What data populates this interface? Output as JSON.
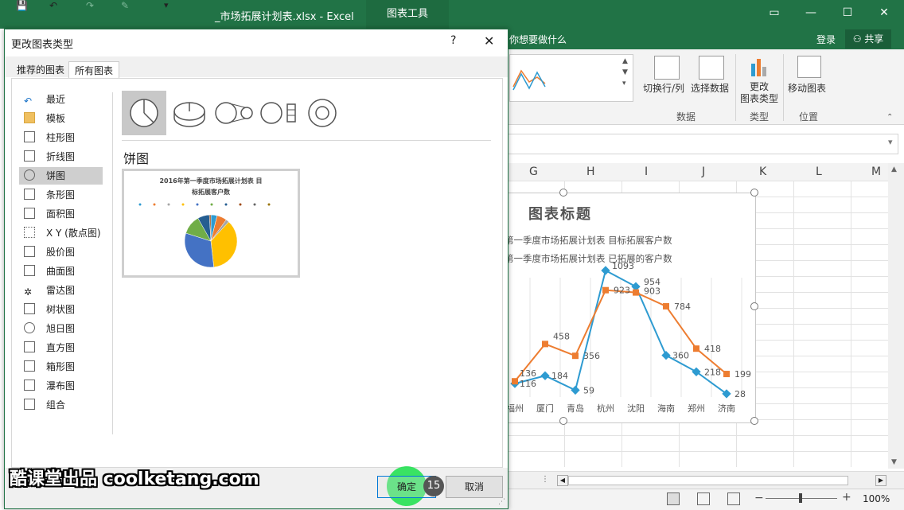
{
  "excel": {
    "filename": "_市场拓展计划表.xlsx - Excel",
    "context_tab": "图表工具",
    "tell_me": "你想要做什么",
    "sign_in": "登录",
    "share": "共享",
    "ribbon": {
      "switch_row_col": "切换行/列",
      "select_data": "选择数据",
      "change_type": "更改\n图表类型",
      "move_chart": "移动图表",
      "group_data": "数据",
      "group_type": "类型",
      "group_location": "位置"
    },
    "columns": [
      "G",
      "H",
      "I",
      "J",
      "K",
      "L",
      "M"
    ],
    "zoom": "100%"
  },
  "chart": {
    "title": "图表标题",
    "legend_1": "第一季度市场拓展计划表 目标拓展客户数",
    "legend_2": "第一季度市场拓展计划表 已拓展的客户数",
    "colors": {
      "series1": "#2e9bd1",
      "series2": "#ed7d31"
    },
    "categories": [
      "福州",
      "厦门",
      "青岛",
      "杭州",
      "沈阳",
      "海南",
      "郑州",
      "济南"
    ]
  },
  "chart_data": {
    "type": "line",
    "categories": [
      "福州",
      "厦门",
      "青岛",
      "杭州",
      "沈阳",
      "海南",
      "郑州",
      "济南"
    ],
    "series": [
      {
        "name": "第一季度市场拓展计划表 目标拓展客户数",
        "values": [
          116,
          184,
          59,
          1093,
          954,
          360,
          218,
          28
        ]
      },
      {
        "name": "第一季度市场拓展计划表 已拓展的客户数",
        "values": [
          136,
          458,
          356,
          923,
          903,
          784,
          418,
          199
        ]
      }
    ],
    "title": "图表标题",
    "grid": true
  },
  "dialog": {
    "title": "更改图表类型",
    "help": "?",
    "close": "✕",
    "tabs": [
      "推荐的图表",
      "所有图表"
    ],
    "sidebar": [
      {
        "label": "最近",
        "icon": "recent-icon"
      },
      {
        "label": "模板",
        "icon": "folder-icon"
      },
      {
        "label": "柱形图",
        "icon": "column-chart-icon"
      },
      {
        "label": "折线图",
        "icon": "line-chart-icon"
      },
      {
        "label": "饼图",
        "icon": "pie-chart-icon"
      },
      {
        "label": "条形图",
        "icon": "bar-chart-icon"
      },
      {
        "label": "面积图",
        "icon": "area-chart-icon"
      },
      {
        "label": "X Y (散点图)",
        "icon": "scatter-chart-icon"
      },
      {
        "label": "股价图",
        "icon": "stock-chart-icon"
      },
      {
        "label": "曲面图",
        "icon": "surface-chart-icon"
      },
      {
        "label": "雷达图",
        "icon": "radar-chart-icon"
      },
      {
        "label": "树状图",
        "icon": "treemap-icon"
      },
      {
        "label": "旭日图",
        "icon": "sunburst-icon"
      },
      {
        "label": "直方图",
        "icon": "histogram-icon"
      },
      {
        "label": "箱形图",
        "icon": "box-whisker-icon"
      },
      {
        "label": "瀑布图",
        "icon": "waterfall-icon"
      },
      {
        "label": "组合",
        "icon": "combo-chart-icon"
      }
    ],
    "selected_type": "饼图",
    "preview_title": "2016年第一季度市场拓展计划表 目\n标拓展客户数",
    "ok": "确定",
    "cancel": "取消"
  },
  "step_number": "15",
  "watermark": "酷课堂出品 coolketang.com"
}
